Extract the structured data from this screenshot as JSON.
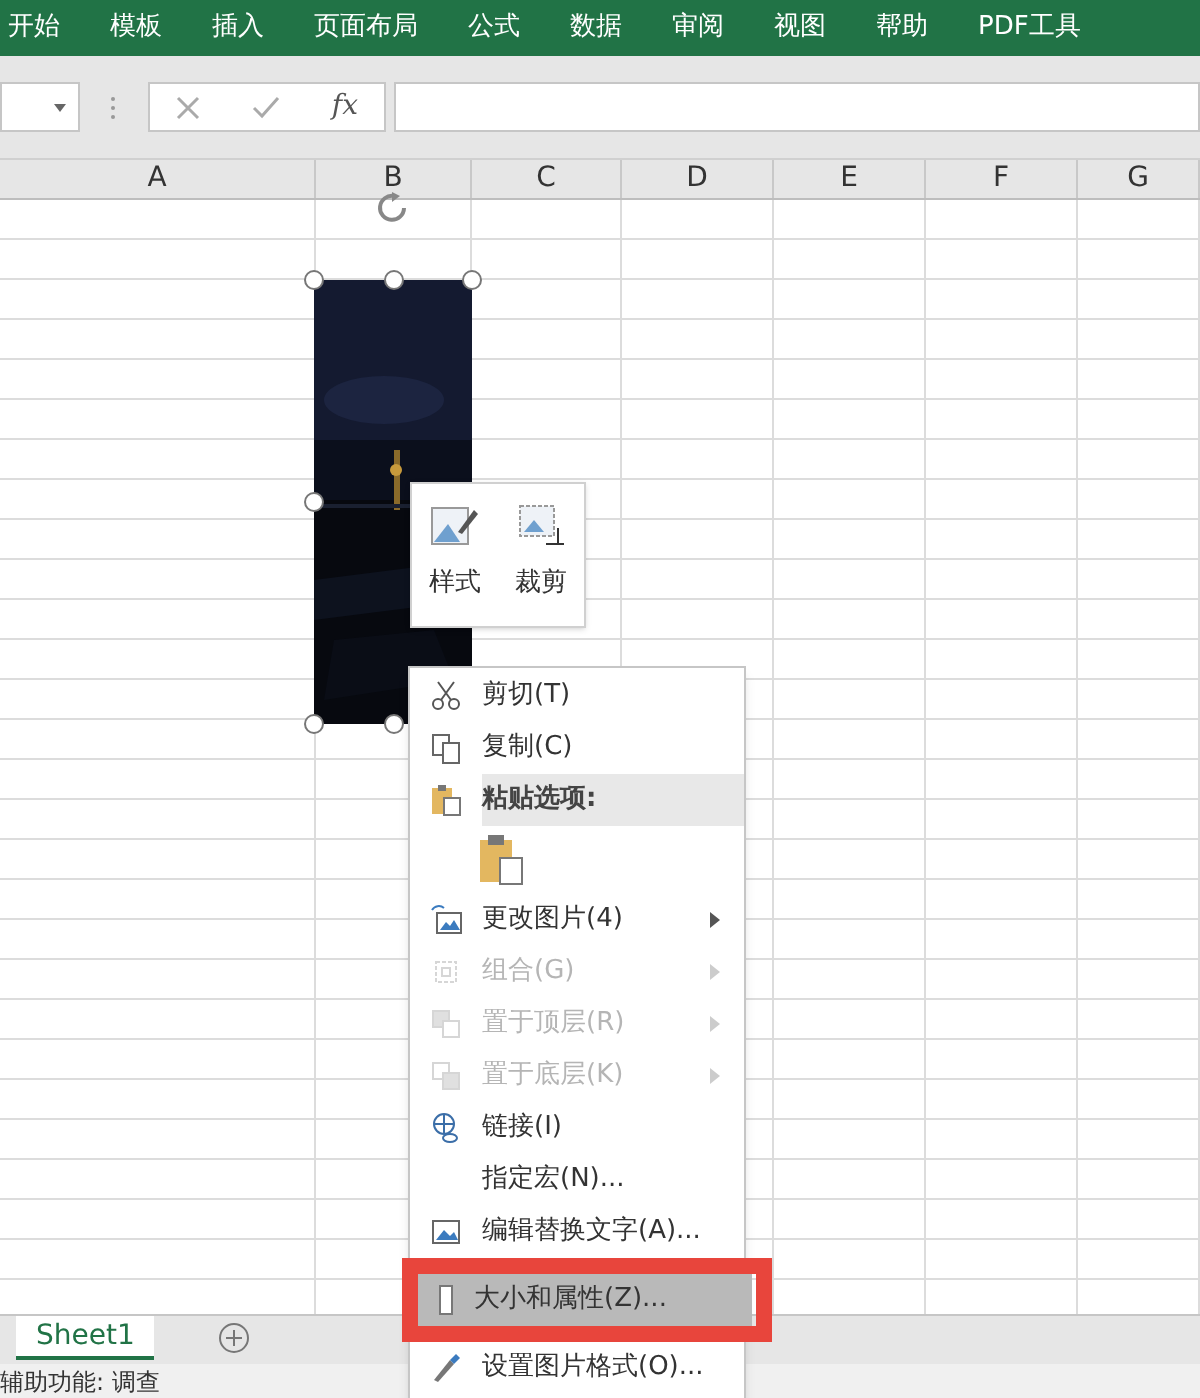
{
  "ribbon_tabs": [
    {
      "label": "开始"
    },
    {
      "label": "模板"
    },
    {
      "label": "插入"
    },
    {
      "label": "页面布局"
    },
    {
      "label": "公式"
    },
    {
      "label": "数据"
    },
    {
      "label": "审阅"
    },
    {
      "label": "视图"
    },
    {
      "label": "帮助"
    },
    {
      "label": "PDF工具"
    }
  ],
  "formula_bar": {
    "fx": "fx"
  },
  "columns": [
    "A",
    "B",
    "C",
    "D",
    "E",
    "F",
    "G"
  ],
  "mini_toolbar": [
    {
      "label": "样式"
    },
    {
      "label": "裁剪"
    }
  ],
  "context_menu": [
    {
      "kind": "item",
      "label": "剪切(T)",
      "disabled": false,
      "submenu": false,
      "selected": false
    },
    {
      "kind": "item",
      "label": "复制(C)",
      "disabled": false,
      "submenu": false,
      "selected": false
    },
    {
      "kind": "header",
      "label": "粘贴选项:"
    },
    {
      "kind": "paste"
    },
    {
      "kind": "item",
      "label": "更改图片(4)",
      "disabled": false,
      "submenu": true,
      "selected": false
    },
    {
      "kind": "item",
      "label": "组合(G)",
      "disabled": true,
      "submenu": true,
      "selected": false
    },
    {
      "kind": "item",
      "label": "置于顶层(R)",
      "disabled": true,
      "submenu": true,
      "selected": false
    },
    {
      "kind": "item",
      "label": "置于底层(K)",
      "disabled": true,
      "submenu": true,
      "selected": false
    },
    {
      "kind": "item",
      "label": "链接(I)",
      "disabled": false,
      "submenu": false,
      "selected": false
    },
    {
      "kind": "item",
      "label": "指定宏(N)...",
      "disabled": false,
      "submenu": false,
      "selected": false
    },
    {
      "kind": "item",
      "label": "编辑替换文字(A)...",
      "disabled": false,
      "submenu": false,
      "selected": false
    },
    {
      "kind": "item",
      "label": "大小和属性(Z)...",
      "disabled": false,
      "submenu": false,
      "selected": true
    },
    {
      "kind": "item",
      "label": "设置图片格式(O)...",
      "disabled": false,
      "submenu": false,
      "selected": false
    }
  ],
  "sheet_tabs": [
    {
      "label": "Sheet1",
      "selected": true
    }
  ],
  "status_bar": {
    "text": "辅助功能: 调查"
  }
}
